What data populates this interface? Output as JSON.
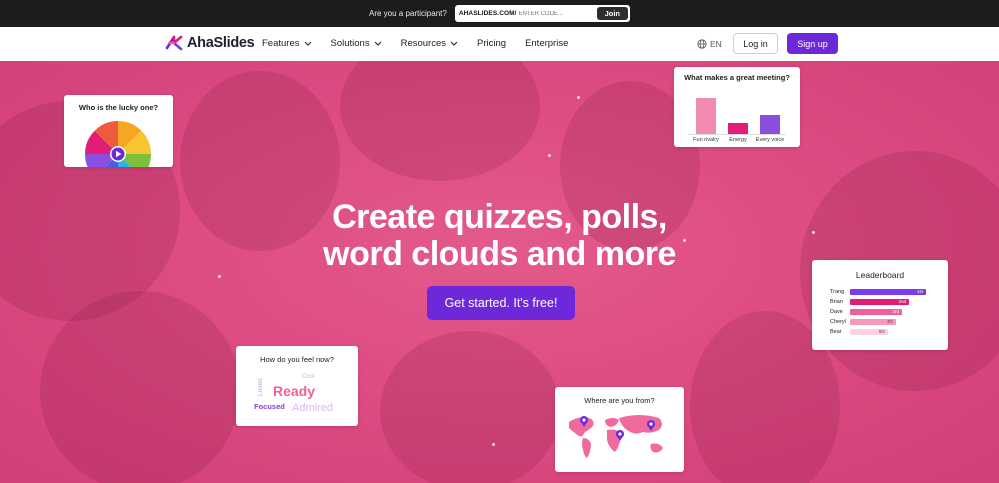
{
  "topbar": {
    "question": "Are you a participant?",
    "url_prefix": "AHASLIDES.COM/",
    "code_placeholder": "ENTER CODE...",
    "join_label": "Join"
  },
  "nav": {
    "logo_text": "AhaSlides",
    "items": [
      {
        "label": "Features",
        "has_dropdown": true
      },
      {
        "label": "Solutions",
        "has_dropdown": true
      },
      {
        "label": "Resources",
        "has_dropdown": true
      },
      {
        "label": "Pricing",
        "has_dropdown": false
      },
      {
        "label": "Enterprise",
        "has_dropdown": false
      }
    ],
    "language": "EN",
    "login_label": "Log in",
    "signup_label": "Sign up"
  },
  "hero": {
    "headline_line1": "Create quizzes, polls,",
    "headline_line2": "word clouds and more",
    "cta_label": "Get started. It's free!"
  },
  "cards": {
    "spinner": {
      "title": "Who is the lucky one?"
    },
    "meeting": {
      "title": "What makes a great meeting?",
      "bars": [
        {
          "label": "Fun rivalry",
          "value": 0.95,
          "color": "#f18bb2"
        },
        {
          "label": "Energy",
          "value": 0.28,
          "color": "#e11d78"
        },
        {
          "label": "Every voice",
          "value": 0.5,
          "color": "#8b4fe0"
        }
      ]
    },
    "leaderboard": {
      "title": "Leaderboard",
      "rows": [
        {
          "name": "Trang",
          "rank": "1st",
          "value": 1.0,
          "color": "#7c3aed"
        },
        {
          "name": "Brian",
          "rank": "2nd",
          "value": 0.78,
          "color": "#e11d78"
        },
        {
          "name": "Dave",
          "rank": "3rd",
          "value": 0.68,
          "color": "#f0609a"
        },
        {
          "name": "Cheryl",
          "rank": "4th",
          "value": 0.6,
          "color": "#f59abc"
        },
        {
          "name": "Bear",
          "rank": "5th",
          "value": 0.5,
          "color": "#fbd2e2"
        }
      ]
    },
    "feel": {
      "title": "How do you feel now?",
      "words": [
        {
          "text": "Ready",
          "color": "#f0609a"
        },
        {
          "text": "Admired",
          "color": "#d9b8f5"
        },
        {
          "text": "Focused",
          "color": "#8b3fd9"
        },
        {
          "text": "Loved",
          "color": "#c79be8"
        },
        {
          "text": "Cool",
          "color": "#c9b6e0"
        }
      ]
    },
    "map": {
      "title": "Where are you from?"
    }
  },
  "colors": {
    "primary": "#6d28d9",
    "hero_pink": "#e2497e",
    "topbar_bg": "#1c1c1c"
  }
}
